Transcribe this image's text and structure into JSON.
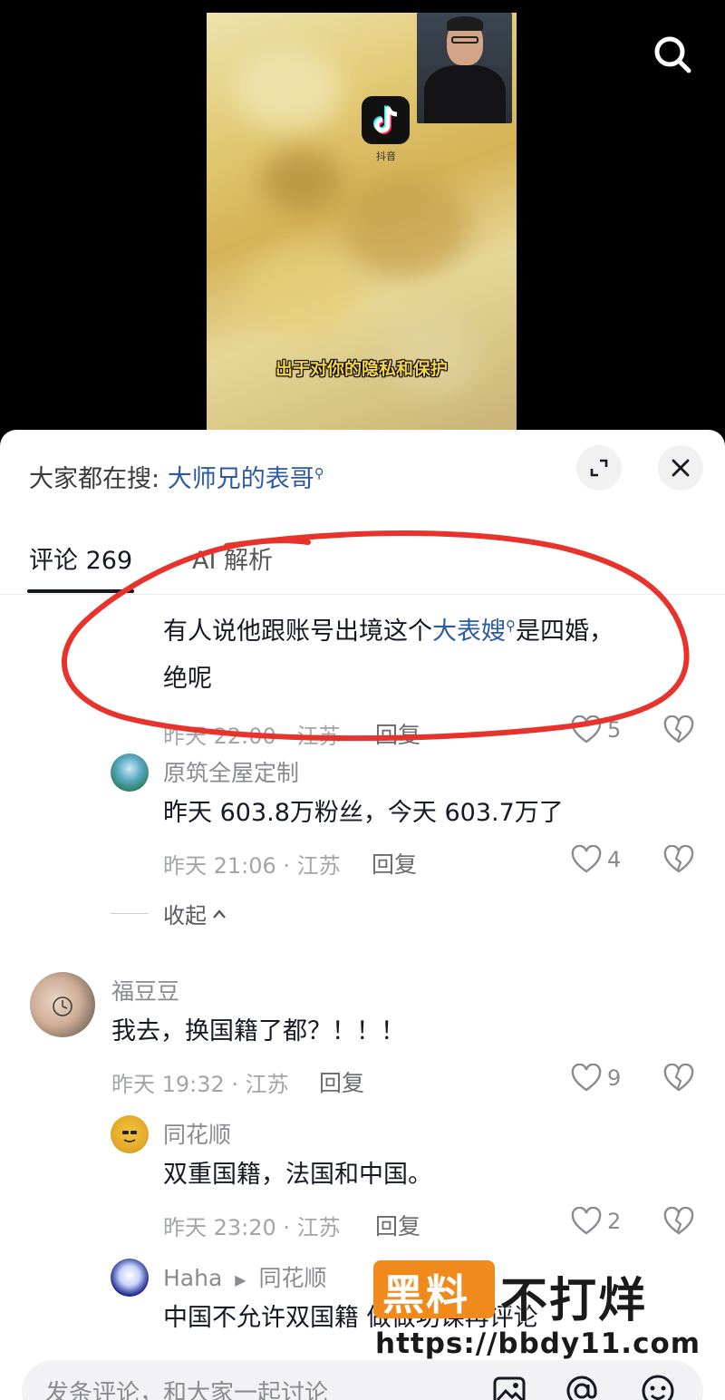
{
  "video": {
    "app_logo_label": "抖音",
    "subtitle": "出于对你的隐私和保护"
  },
  "sheet": {
    "hot_search_prefix": "大家都在搜:",
    "hot_search_term": "大师兄的表哥",
    "tabs": [
      {
        "label": "评论 269"
      },
      {
        "label": "AI 解析"
      }
    ]
  },
  "comments": [
    {
      "text_pre": "有人说他跟账号出境这个",
      "text_link": "大表嫂",
      "text_post": "是四婚，",
      "text_line2": "绝呢",
      "meta": "昨天 22:00 · 江苏",
      "reply_label": "回复",
      "likes": "5"
    },
    {
      "name": "原筑全屋定制",
      "text": "昨天 603.8万粉丝，今天 603.7万了",
      "meta": "昨天 21:06 · 江苏",
      "reply_label": "回复",
      "likes": "4"
    },
    {
      "collapse_label": "收起"
    },
    {
      "name": "福豆豆",
      "text": "我去，换国籍了都？！！！",
      "meta": "昨天 19:32 · 江苏",
      "reply_label": "回复",
      "likes": "9"
    },
    {
      "name": "同花顺",
      "text": "双重国籍，法国和中国。",
      "meta": "昨天 23:20 · 江苏",
      "reply_label": "回复",
      "likes": "2"
    },
    {
      "name": "Haha",
      "reply_to": "同花顺",
      "text": "中国不允许双国籍 做做功课再评论"
    }
  ],
  "watermark": {
    "logo": "黑料",
    "text": "不打烊",
    "url": "https://bbdy11.com"
  },
  "input": {
    "placeholder": "发条评论，和大家一起讨论"
  },
  "colors": {
    "link": "#2c5aa0",
    "annotation_red": "#e8322c",
    "watermark_orange": "#f08a1c"
  }
}
